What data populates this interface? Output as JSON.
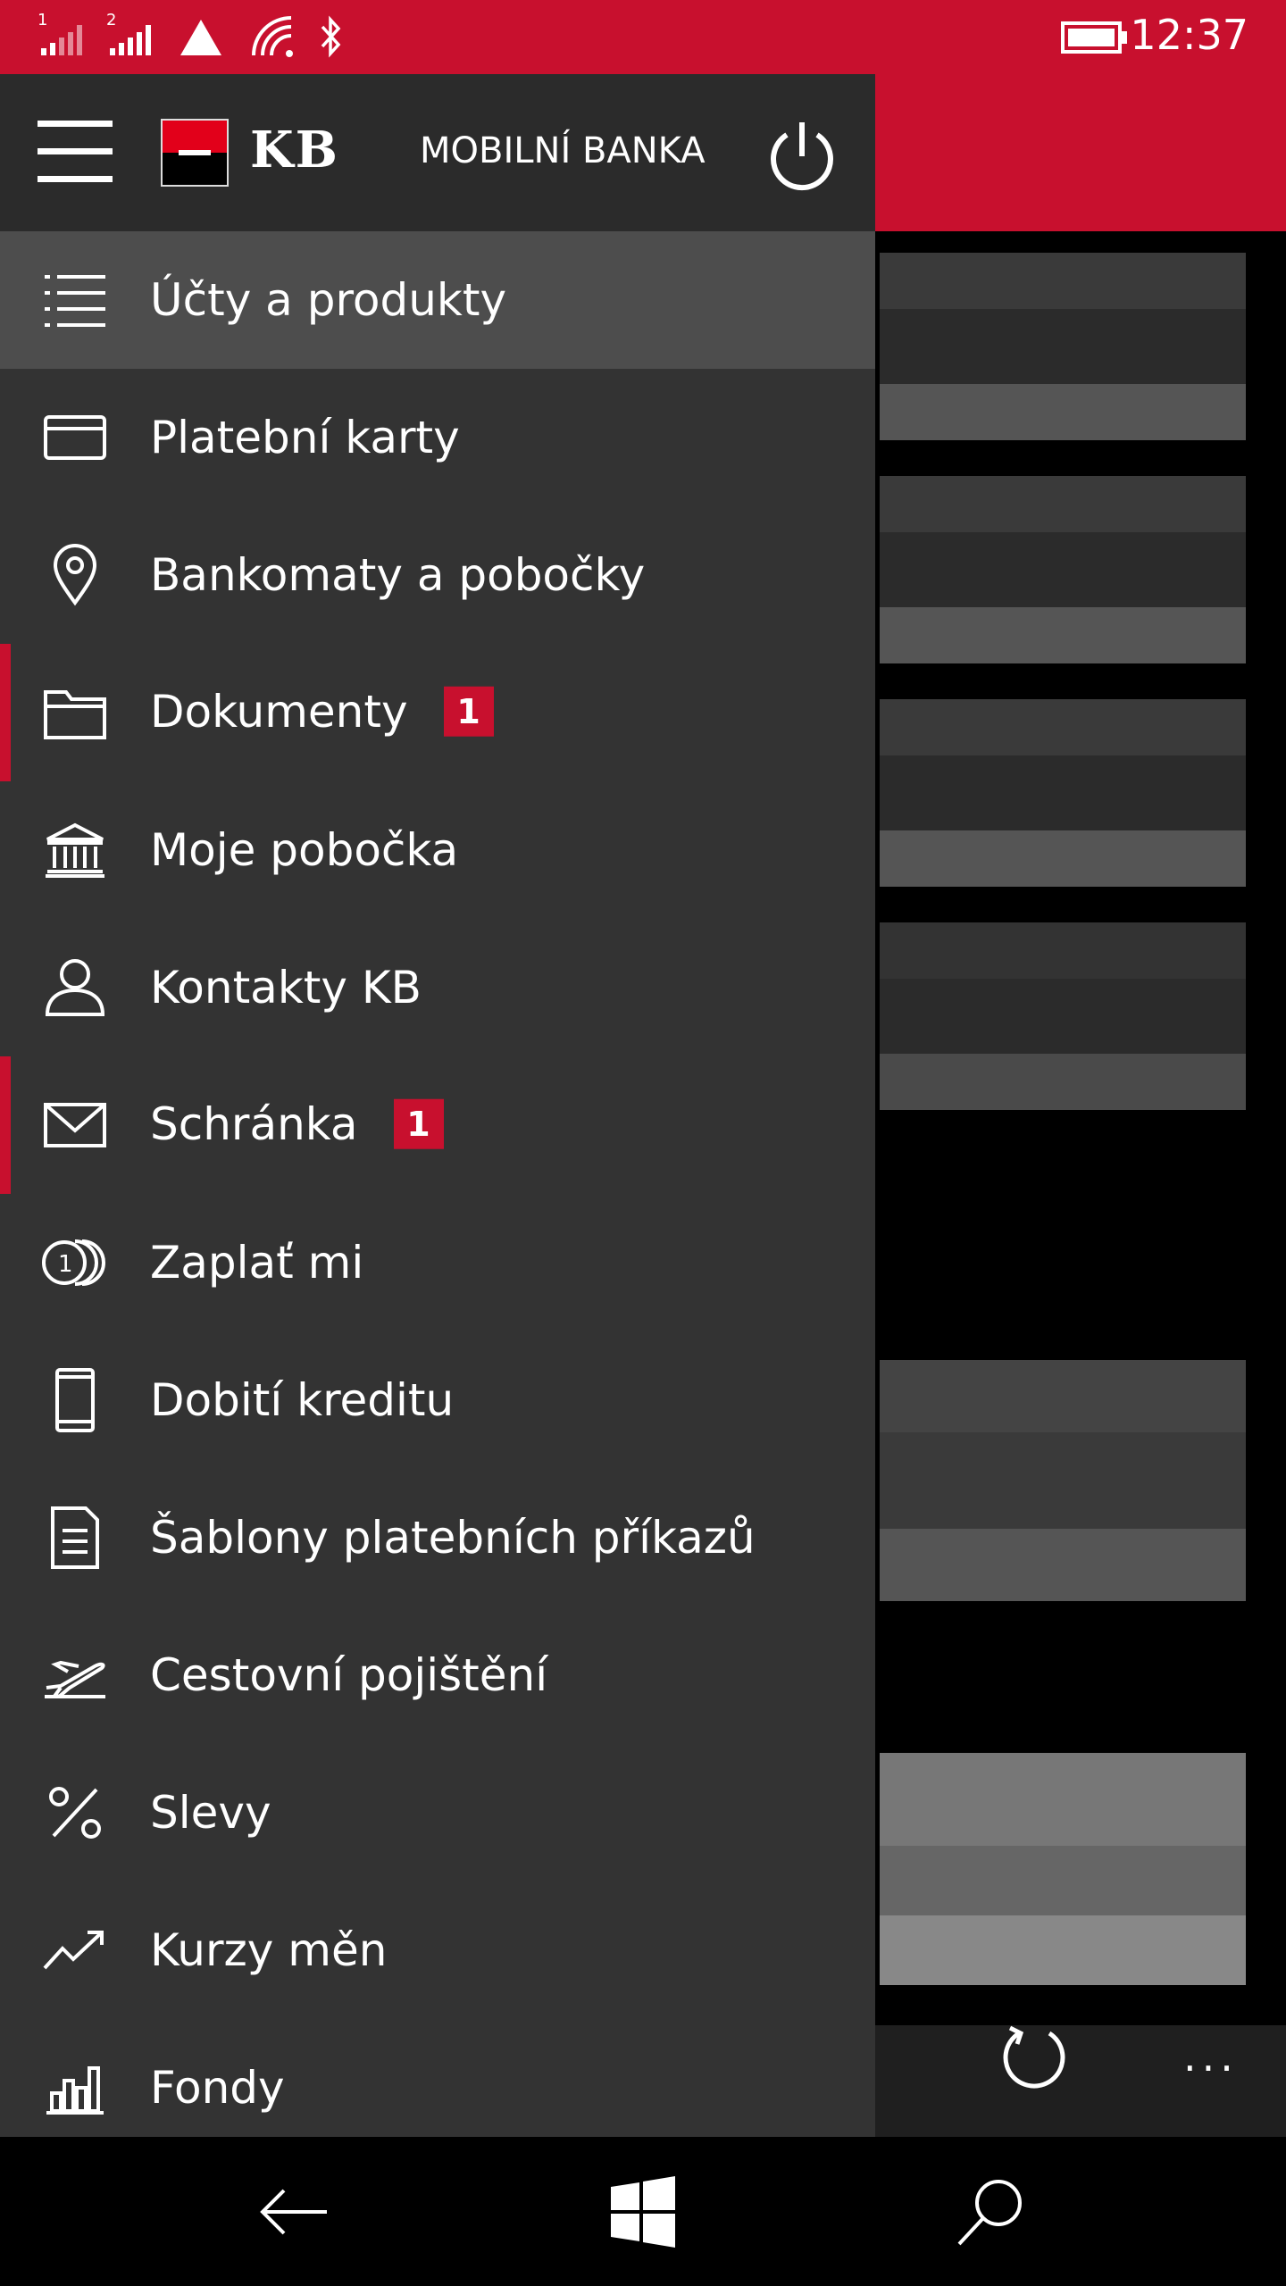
{
  "status_bar": {
    "sim1": "1",
    "sim2": "2",
    "time": "12:37",
    "icons": [
      "signal-sim1-icon",
      "signal-sim2-icon",
      "data-warning-icon",
      "wifi-icon",
      "bluetooth-icon",
      "battery-icon"
    ]
  },
  "header": {
    "logo_text": "KB",
    "title": "MOBILNÍ BANKA",
    "menu_icon": "hamburger-icon",
    "power_icon": "power-icon"
  },
  "menu": {
    "items": [
      {
        "label": "Účty a produkty",
        "icon": "list-icon",
        "selected": true
      },
      {
        "label": "Platební karty",
        "icon": "card-icon"
      },
      {
        "label": "Bankomaty a pobočky",
        "icon": "location-pin-icon"
      },
      {
        "label": "Dokumenty",
        "icon": "folder-icon",
        "badge": "1"
      },
      {
        "label": "Moje pobočka",
        "icon": "bank-building-icon"
      },
      {
        "label": "Kontakty KB",
        "icon": "person-icon"
      },
      {
        "label": "Schránka",
        "icon": "mail-icon",
        "badge": "1"
      },
      {
        "label": "Zaplať mi",
        "icon": "coins-icon"
      },
      {
        "label": "Dobití kreditu",
        "icon": "phone-icon"
      },
      {
        "label": "Šablony platebních příkazů",
        "icon": "document-icon"
      },
      {
        "label": "Cestovní pojištění",
        "icon": "airplane-icon"
      },
      {
        "label": "Slevy",
        "icon": "percent-icon"
      },
      {
        "label": "Kurzy měn",
        "icon": "trend-up-icon"
      },
      {
        "label": "Fondy",
        "icon": "bar-chart-icon"
      }
    ]
  },
  "app_bar": {
    "refresh_icon": "refresh-icon",
    "more_label": "..."
  },
  "nav_bar": {
    "icons": [
      "back-icon",
      "windows-icon",
      "search-icon"
    ]
  },
  "colors": {
    "accent": "#c8102e",
    "drawer_bg": "#333333",
    "selected_bg": "#4d4d4d"
  }
}
